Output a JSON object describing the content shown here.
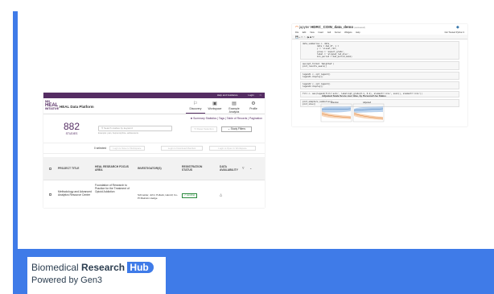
{
  "heal": {
    "topbar": [
      "Help and Guidance",
      "Login"
    ],
    "logo_top": "NIH",
    "logo_big": "HEAL",
    "logo_bottom": "INITIATIVE",
    "title": "HEAL Data Platform",
    "nav": [
      {
        "label": "Discovery",
        "icon": "discovery-icon"
      },
      {
        "label": "Workspace",
        "icon": "workspace-icon"
      },
      {
        "label": "Example Analysis",
        "icon": "chart-icon"
      },
      {
        "label": "Profile",
        "icon": "gear-icon"
      }
    ],
    "links": "Summary Statistics | Tags | Table of Records | Pagination",
    "count": "882",
    "count_label": "STUDIES",
    "search_placeholder": "Search studies by keyword",
    "search_help": "Example: pain, buprenorphine, adolescents",
    "reset_label": "Reset Selection",
    "study_filters_label": "Study Filters",
    "selected_text": "0 selected",
    "action_buttons": [
      "Login to Save to Workspace",
      "Login to Download Manifest",
      "Login to Open In Workspace"
    ],
    "columns": [
      "PROJECT TITLE",
      "HEAL RESEARCH FOCUS AREA",
      "INVESTIGATOR(S)",
      "REGISTRATION STATUS",
      "DATA AVAILABILITY"
    ],
    "row": {
      "title": "Methodology and Advanced Analytics Resource Center",
      "focus": "Foundation of Research to Practice for the Treatment of Opioid Addiction",
      "investigators": "Schneider, John; Pollack, Harold; Co-PI Malcolm Hedge",
      "status": "pending"
    }
  },
  "jupyter": {
    "logo": "jupyter",
    "notebook": "HDRC_COIN_data_demo",
    "saved": "(autosaved)",
    "menu": [
      "File",
      "Edit",
      "View",
      "Insert",
      "Cell",
      "Kernel",
      "Widgets",
      "Help"
    ],
    "right_text": "Not Trusted   Python 3",
    "code": [
      "data_summarise <- data_\n            data = dem_df, x =\n            y = 'visual_rad',\n            group = 'aspect_grade',\n            label = 'aligned_rad_plus',\n            min_period = mad_period_mean)",
      "aws(opt_format 'Weighted')\nplot_results_aware()",
      "legend1 <- opt_legend()\nlegend1.display()",
      "legend2 <- opt_legend()\nlegend2.display()",
      "fill <- aes(legend(fill='auto', label=opt_grade(0.1, 0.2), element='cols', eval(), element='cols'))",
      "plot_adapters_summaries()\nplot_show()"
    ],
    "plot_title": "Adjusted Scale Score over time, by Personal Use Status",
    "plot_subtitles": [
      "Intention",
      "Adjusted"
    ]
  },
  "footer": {
    "title_plain": "Biomedical ",
    "title_bold": "Research",
    "title_pill": "Hub",
    "subtitle": "Powered by Gen3"
  },
  "colors": {
    "accent_blue": "#3f7be8",
    "heal_purple": "#552d63",
    "jupyter_orange": "#f37726"
  }
}
